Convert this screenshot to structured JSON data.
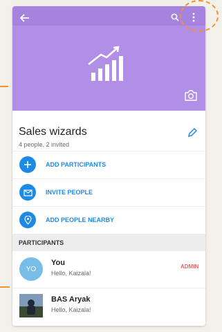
{
  "header": {
    "back_icon": "arrow-back-icon",
    "search_icon": "search-icon",
    "more_icon": "more-vert-icon",
    "hero_icon": "signal-bars-chart-icon",
    "camera_icon": "camera-icon",
    "colors": {
      "header_bg": "#b28fe6"
    }
  },
  "group": {
    "name": "Sales wizards",
    "subtitle": "4 people, 2 invited",
    "edit_icon": "pencil-icon"
  },
  "actions": [
    {
      "label": "ADD PARTICIPANTS",
      "icon": "plus-icon"
    },
    {
      "label": "INVITE PEOPLE",
      "icon": "envelope-icon"
    },
    {
      "label": "ADD PEOPLE NEARBY",
      "icon": "location-pin-icon"
    }
  ],
  "participants": {
    "heading": "PARTICIPANTS",
    "members": [
      {
        "initials": "YO",
        "name": "You",
        "status": "Hello, Kaizala!",
        "role": "ADMIN",
        "avatar_color": "#77bde8"
      },
      {
        "initials": "",
        "name": "BAS Aryak",
        "status": "Hello, Kaizala!",
        "role": "",
        "avatar_color": "#2f3f55"
      }
    ]
  },
  "accent_color": "#1c8be6",
  "annotation_color": "#f39230"
}
